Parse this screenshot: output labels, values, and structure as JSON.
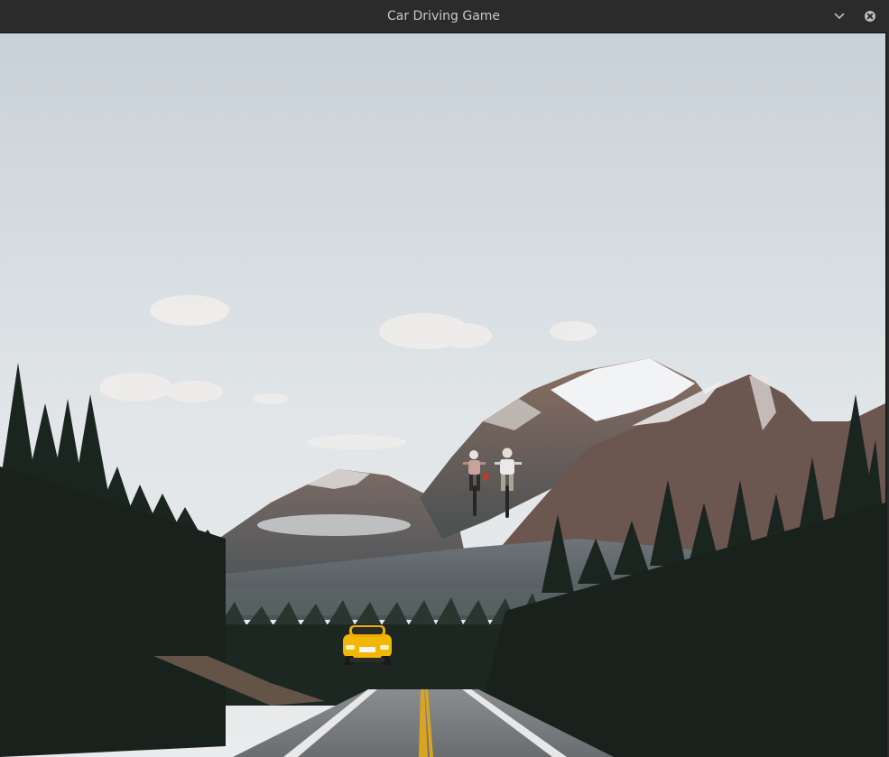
{
  "window": {
    "title": "Car Driving Game"
  },
  "scene": {
    "background": "mountain road with pine forest"
  },
  "colors": {
    "sky_top": "#c9d3da",
    "sky_bottom": "#e6eaec",
    "car": "#f2b705",
    "forest": "#1f2a22",
    "road": "#7a7d80"
  },
  "icons": {
    "minimize": "chevron-down-icon",
    "close": "close-icon"
  }
}
